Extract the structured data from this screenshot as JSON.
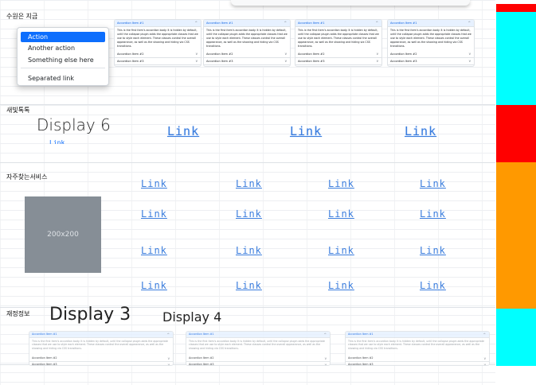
{
  "sections": {
    "s1": "수원은 지금",
    "s2": "새빛톡톡",
    "s3": "자주찾는서비스",
    "s4": "재정정보"
  },
  "dropdown": {
    "items": [
      "Action",
      "Another action",
      "Something else here"
    ],
    "separated": "Separated link"
  },
  "accordion": {
    "item1": "Accordion Item #1",
    "item2": "Accordion Item #2",
    "item3": "Accordion Item #3",
    "body": "This is the first item's accordion body. It is hidden by default, until the collapse plugin adds the appropriate classes that we use to style each element. These classes control the overall appearance, as well as the showing and hiding via CSS transitions."
  },
  "display6": "Display 6",
  "display3": "Display 3",
  "display4": "Display 4",
  "link_label": "Link",
  "placeholder": "200x200",
  "colors": {
    "red": "#ff0000",
    "cyan": "#00ffff",
    "orange": "#ff9900",
    "primary": "#0d6efd"
  }
}
